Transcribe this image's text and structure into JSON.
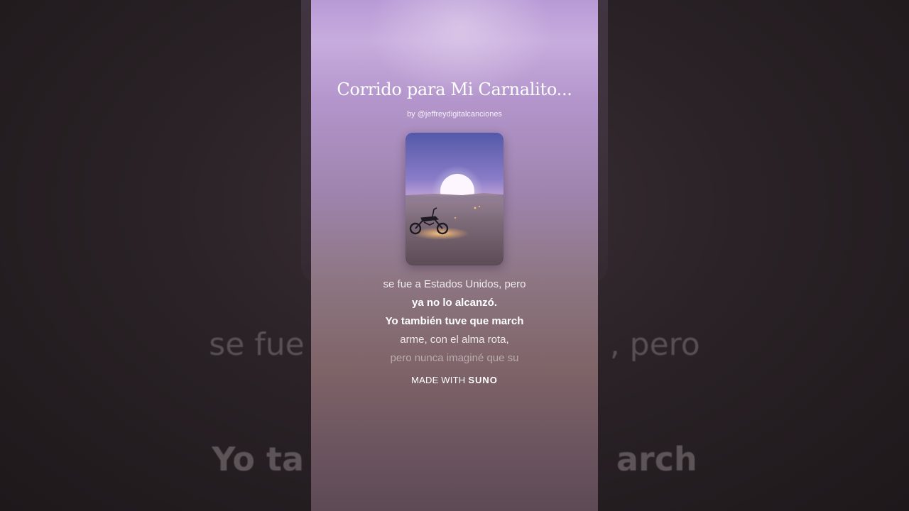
{
  "song": {
    "title": "Corrido para Mi Carnalito...",
    "byline": "by @jeffreydigitalcanciones"
  },
  "lyrics": [
    {
      "text": "se fue a Estados Unidos, pero",
      "style": "dim"
    },
    {
      "text": "ya no lo alcanzó.",
      "style": "bold"
    },
    {
      "text": "Yo también tuve que march",
      "style": "bold"
    },
    {
      "text": "arme, con el alma rota,",
      "style": "dim"
    },
    {
      "text": "pero nunca imaginé que su",
      "style": "fade"
    }
  ],
  "background_lyrics": {
    "line1_left": "se fue",
    "line1_right": ", pero",
    "line2_left": "Yo ta",
    "line2_right": "arch"
  },
  "footer": {
    "made_with": "MADE WITH",
    "brand": "SUNO"
  },
  "cover_art": {
    "sky_top": "#5b5fb0",
    "sky_mid": "#a78fd0",
    "sun": "#fbf4ff",
    "ground": "#6b5a66"
  }
}
